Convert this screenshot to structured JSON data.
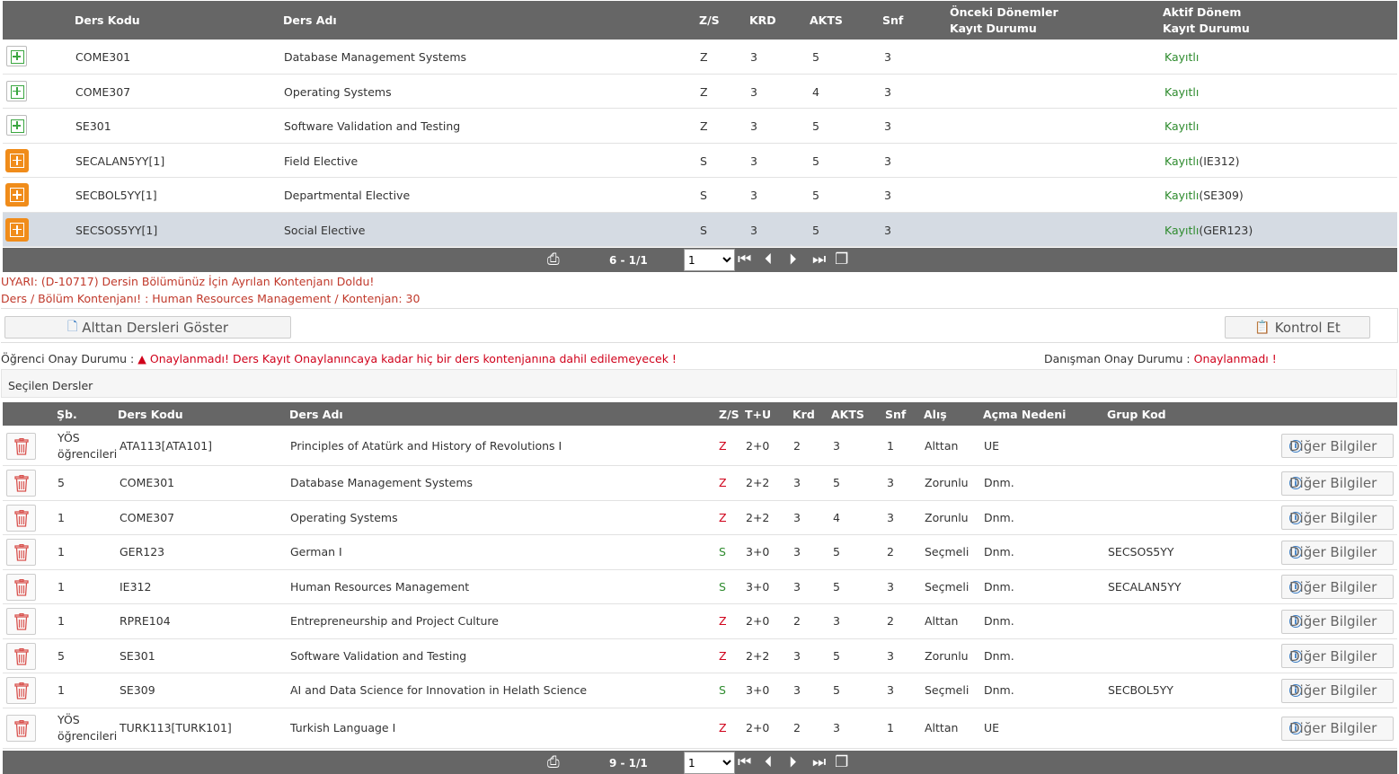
{
  "top_table": {
    "headers": {
      "code": "Ders Kodu",
      "name": "Ders Adı",
      "zs": "Z/S",
      "krd": "KRD",
      "akts": "AKTS",
      "snf": "Snf",
      "prev_l1": "Önceki Dönemler",
      "prev_l2": "Kayıt Durumu",
      "active_l1": "Aktif Dönem",
      "active_l2": "Kayıt Durumu"
    },
    "rows": [
      {
        "icon": "green",
        "code": "COME301",
        "name": "Database Management Systems",
        "zs": "Z",
        "krd": "3",
        "akts": "5",
        "snf": "3",
        "prev": "",
        "status": "Kayıtlı",
        "status_extra": ""
      },
      {
        "icon": "green",
        "code": "COME307",
        "name": "Operating Systems",
        "zs": "Z",
        "krd": "3",
        "akts": "4",
        "snf": "3",
        "prev": "",
        "status": "Kayıtlı",
        "status_extra": ""
      },
      {
        "icon": "green",
        "code": "SE301",
        "name": "Software Validation and Testing",
        "zs": "Z",
        "krd": "3",
        "akts": "5",
        "snf": "3",
        "prev": "",
        "status": "Kayıtlı",
        "status_extra": ""
      },
      {
        "icon": "orange",
        "code": "SECALAN5YY[1]",
        "name": "Field Elective",
        "zs": "S",
        "krd": "3",
        "akts": "5",
        "snf": "3",
        "prev": "",
        "status": "Kayıtlı",
        "status_extra": "(IE312)"
      },
      {
        "icon": "orange",
        "code": "SECBOL5YY[1]",
        "name": "Departmental Elective",
        "zs": "S",
        "krd": "3",
        "akts": "5",
        "snf": "3",
        "prev": "",
        "status": "Kayıtlı",
        "status_extra": "(SE309)"
      },
      {
        "icon": "orange",
        "code": "SECSOS5YY[1]",
        "name": "Social Elective",
        "zs": "S",
        "krd": "3",
        "akts": "5",
        "snf": "3",
        "prev": "",
        "status": "Kayıtlı",
        "status_extra": "(GER123)"
      }
    ],
    "pager": {
      "info": "6 - 1/1",
      "page": "1"
    }
  },
  "warning": {
    "line1": "UYARI: (D-10717) Dersin Bölümünüz İçin Ayrılan Kontenjanı Doldu!",
    "line2_label": "Ders / Bölüm Kontenjanı! :",
    "line2_value": " Human Resources Management / Kontenjan: 30"
  },
  "buttons": {
    "show_sub": "Alttan Dersleri Göster",
    "check": "Kontrol Et"
  },
  "approval": {
    "student_label": "Öğrenci Onay Durumu :",
    "student_value": "Onaylanmadı! Ders Kayıt Onaylanıncaya kadar hiç bir ders kontenjanına dahil edilemeyecek !",
    "advisor_label": "Danışman Onay Durumu :",
    "advisor_value": "Onaylanmadı !"
  },
  "selected": {
    "title": "Seçilen Dersler",
    "headers": {
      "sb": "Şb.",
      "code": "Ders Kodu",
      "name": "Ders Adı",
      "zs": "Z/S",
      "tu": "T+U",
      "krd": "Krd",
      "akts": "AKTS",
      "snf": "Snf",
      "alis": "Alış",
      "reason": "Açma Nedeni",
      "group": "Grup Kod"
    },
    "details_label": "Diğer Bilgiler",
    "rows": [
      {
        "sb": "YÖS öğrencileri",
        "code": "ATA113[ATA101]",
        "name": "Principles of Atatürk and History of Revolutions I",
        "zs": "Z",
        "tu": "2+0",
        "krd": "2",
        "akts": "3",
        "snf": "1",
        "alis": "Alttan",
        "reason": "UE",
        "group": ""
      },
      {
        "sb": "5",
        "code": "COME301",
        "name": "Database Management Systems",
        "zs": "Z",
        "tu": "2+2",
        "krd": "3",
        "akts": "5",
        "snf": "3",
        "alis": "Zorunlu",
        "reason": "Dnm.",
        "group": ""
      },
      {
        "sb": "1",
        "code": "COME307",
        "name": "Operating Systems",
        "zs": "Z",
        "tu": "2+2",
        "krd": "3",
        "akts": "4",
        "snf": "3",
        "alis": "Zorunlu",
        "reason": "Dnm.",
        "group": ""
      },
      {
        "sb": "1",
        "code": "GER123",
        "name": "German I",
        "zs": "S",
        "tu": "3+0",
        "krd": "3",
        "akts": "5",
        "snf": "2",
        "alis": "Seçmeli",
        "reason": "Dnm.",
        "group": "SECSOS5YY"
      },
      {
        "sb": "1",
        "code": "IE312",
        "name": "Human Resources Management",
        "zs": "S",
        "tu": "3+0",
        "krd": "3",
        "akts": "5",
        "snf": "3",
        "alis": "Seçmeli",
        "reason": "Dnm.",
        "group": "SECALAN5YY"
      },
      {
        "sb": "1",
        "code": "RPRE104",
        "name": "Entrepreneurship and Project Culture",
        "zs": "Z",
        "tu": "2+0",
        "krd": "2",
        "akts": "3",
        "snf": "2",
        "alis": "Alttan",
        "reason": "Dnm.",
        "group": ""
      },
      {
        "sb": "5",
        "code": "SE301",
        "name": "Software Validation and Testing",
        "zs": "Z",
        "tu": "2+2",
        "krd": "3",
        "akts": "5",
        "snf": "3",
        "alis": "Zorunlu",
        "reason": "Dnm.",
        "group": ""
      },
      {
        "sb": "1",
        "code": "SE309",
        "name": "AI and Data Science for Innovation in Helath Science",
        "zs": "S",
        "tu": "3+0",
        "krd": "3",
        "akts": "5",
        "snf": "3",
        "alis": "Seçmeli",
        "reason": "Dnm.",
        "group": "SECBOL5YY"
      },
      {
        "sb": "YÖS öğrencileri",
        "code": "TURK113[TURK101]",
        "name": "Turkish Language I",
        "zs": "Z",
        "tu": "2+0",
        "krd": "2",
        "akts": "3",
        "snf": "1",
        "alis": "Alttan",
        "reason": "UE",
        "group": ""
      }
    ],
    "pager": {
      "info": "9 - 1/1",
      "page": "1"
    }
  }
}
